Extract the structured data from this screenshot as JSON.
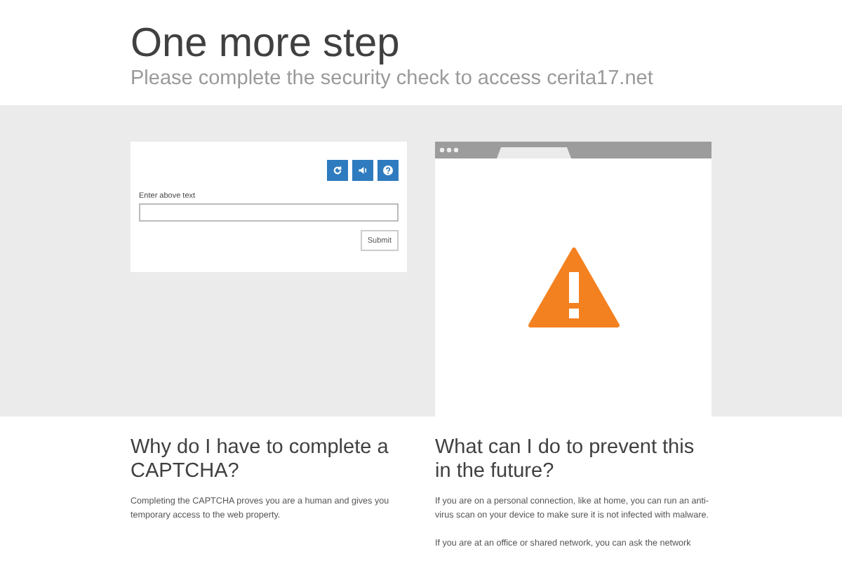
{
  "header": {
    "title": "One more step",
    "subtitle": "Please complete the security check to access cerita17.net"
  },
  "captcha": {
    "buttons": [
      {
        "kind": "refresh"
      },
      {
        "kind": "audio"
      },
      {
        "kind": "help"
      }
    ],
    "field_label": "Enter above text",
    "submit": "Submit"
  },
  "sections": [
    {
      "heading": "Why do I have to complete a CAPTCHA?",
      "paragraphs": [
        "Completing the CAPTCHA proves you are a human and gives you temporary access to the web property."
      ]
    },
    {
      "heading": "What can I do to prevent this in the future?",
      "paragraphs": [
        "If you are on a personal connection, like at home, you can run an anti-virus scan on your device to make sure it is not infected with malware.",
        "If you are at an office or shared network, you can ask the network"
      ]
    }
  ]
}
